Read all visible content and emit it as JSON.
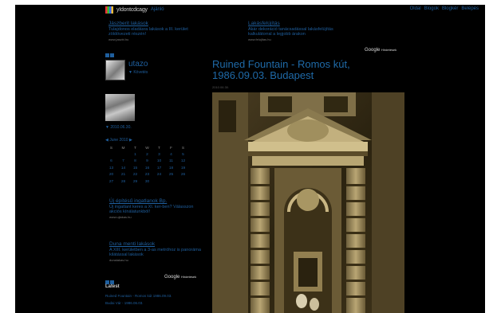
{
  "topbar": {
    "logo_text": "yIdontcdcagy",
    "logo_link": "Ajänló",
    "links": [
      "Oldal",
      "Blogok",
      "Blogkér",
      "Belépés"
    ]
  },
  "ads_top": [
    {
      "title": "Jászberit lakások",
      "text": "Tulajdonos eladásra lakások a III. kerület zöldövezeti részén!",
      "url": "www.jaszbi.hu"
    },
    {
      "title": "Lakásfelújítás",
      "text": "Akár dekoráció tanácsadással lakásfelújítás kalkulátorral a legjobb árakon",
      "url": "www.felujitas.hu"
    }
  ],
  "google_ads_label": "Google",
  "google_ads_sub": "Hirdetések",
  "profile": {
    "username": "utazo",
    "subscribe": "▼ Követés"
  },
  "thumb": {
    "date": "▼ 2010.06.30."
  },
  "calendar": {
    "header": "◀ June 2010 ▶",
    "days": [
      "S",
      "M",
      "T",
      "W",
      "T",
      "F",
      "S"
    ],
    "weeks": [
      [
        "",
        "",
        "1",
        "2",
        "3",
        "4",
        "5"
      ],
      [
        "6",
        "7",
        "8",
        "9",
        "10",
        "11",
        "12"
      ],
      [
        "13",
        "14",
        "15",
        "16",
        "17",
        "18",
        "19"
      ],
      [
        "20",
        "21",
        "22",
        "23",
        "24",
        "25",
        "26"
      ],
      [
        "27",
        "28",
        "29",
        "30",
        "",
        "",
        ""
      ]
    ]
  },
  "ads_side": [
    {
      "title": "Új építésű ingatlanok Bp.",
      "text": "Új ingatlant keres a XI. ker-ben? Válasszon akciós kínálatunkból!",
      "url": "www.ujlakas.hu"
    },
    {
      "title": "Duna menti lakások",
      "text": "A XIII. kerületben a 3-as metróhoz is panoráma kilátással lakások",
      "url": "dunalakas.hu"
    }
  ],
  "sidebar_section": {
    "heading": "Latest",
    "items": [
      "Ruined Fountain - Romos kút 1986.09.03.",
      "Budai Vár - 1986.06.03."
    ]
  },
  "post": {
    "title": "Ruined Fountain - Romos kút, 1986.09.03. Budapest",
    "date": "2010.06.30."
  }
}
